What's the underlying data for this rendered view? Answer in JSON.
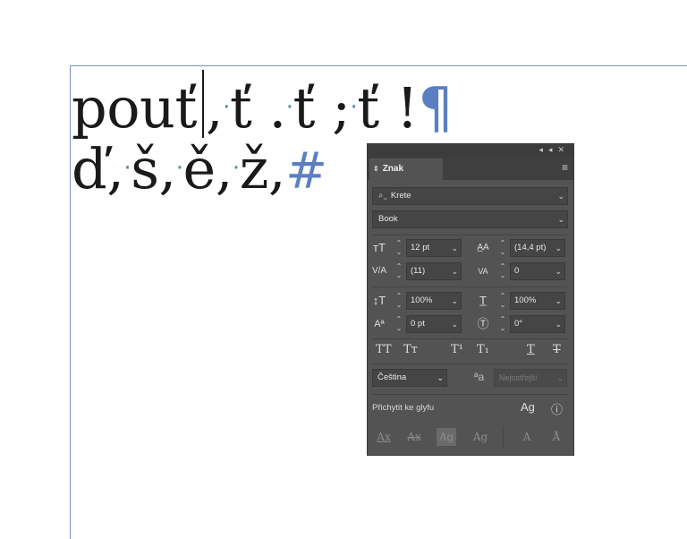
{
  "document": {
    "line1": {
      "w1": "pouť",
      "w2": "ť",
      "w3": "ť",
      "w4": "ť",
      "comma": ",",
      "period": ".",
      "semicolon": ";",
      "excl": "!"
    },
    "line2": {
      "c1": "ď",
      "c2": "š",
      "c3": "ě",
      "c4": "ž",
      "comma": ","
    },
    "hidden_chars": {
      "space_dot": "·",
      "pilcrow": "¶",
      "hash": "#"
    }
  },
  "panel": {
    "title": "Znak",
    "font_family": "Krete",
    "font_style": "Book",
    "font_size": "12 pt",
    "leading": "(14,4 pt)",
    "kerning": "(11)",
    "tracking": "0",
    "vertical_scale": "100%",
    "horizontal_scale": "100%",
    "baseline_shift": "0 pt",
    "rotation": "0°",
    "format_buttons": [
      "TT",
      "Tт",
      "T¹",
      "T₁",
      "T",
      "T"
    ],
    "language": "Čeština",
    "anti_alias": "Nejostřejší",
    "snap_label": "Přichytit ke glyfu"
  },
  "icons": {
    "search": "search-icon",
    "menu": "menu-icon",
    "collapse": "collapse-icon",
    "close": "close-icon"
  }
}
